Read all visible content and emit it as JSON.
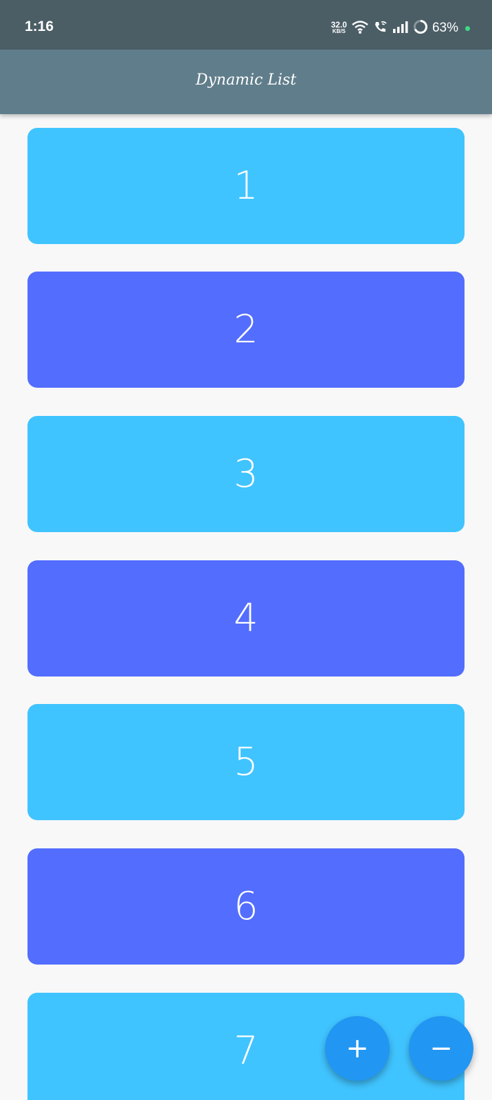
{
  "status_bar": {
    "time": "1:16",
    "net_speed_value": "32.0",
    "net_speed_unit": "KB/S",
    "battery": "63%"
  },
  "app_bar": {
    "title": "Dynamic List"
  },
  "list": {
    "items": [
      {
        "label": "1",
        "color": "#40c4ff"
      },
      {
        "label": "2",
        "color": "#536dfe"
      },
      {
        "label": "3",
        "color": "#40c4ff"
      },
      {
        "label": "4",
        "color": "#536dfe"
      },
      {
        "label": "5",
        "color": "#40c4ff"
      },
      {
        "label": "6",
        "color": "#536dfe"
      },
      {
        "label": "7",
        "color": "#40c4ff"
      }
    ]
  },
  "fabs": {
    "add_icon": "+",
    "remove_icon": "−"
  }
}
